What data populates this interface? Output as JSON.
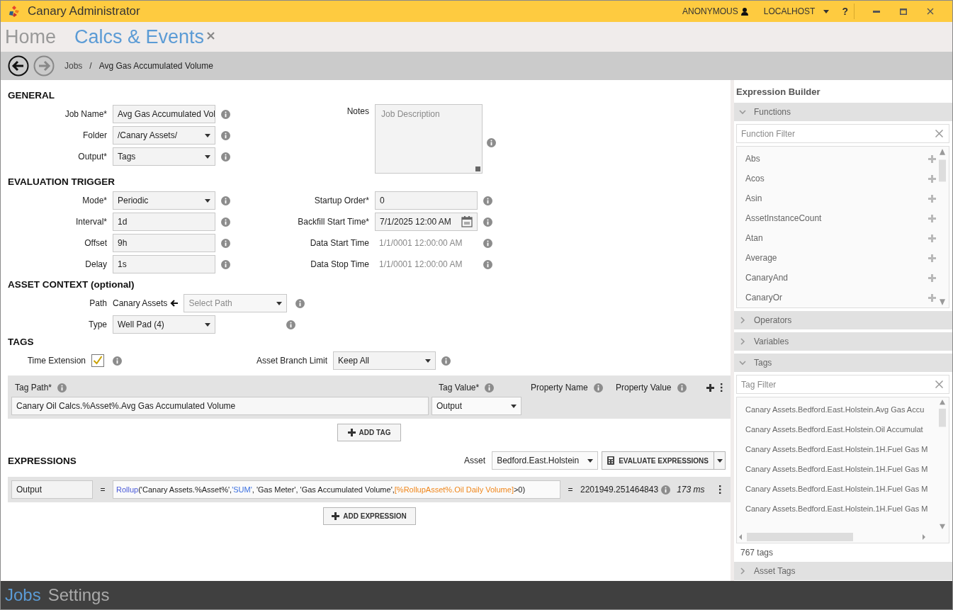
{
  "title_bar": {
    "app_title": "Canary Administrator",
    "user": "ANONYMOUS",
    "server": "LOCALHOST",
    "help": "?"
  },
  "top_tabs": [
    {
      "label": "Home",
      "selected": false,
      "closable": false
    },
    {
      "label": "Calcs & Events",
      "selected": true,
      "closable": true
    }
  ],
  "navigation": {
    "back_enabled": true,
    "forward_enabled": false
  },
  "breadcrumb": {
    "items": [
      "Jobs",
      "Avg Gas Accumulated Volume"
    ],
    "separator": "/"
  },
  "general": {
    "heading": "GENERAL",
    "fields": [
      {
        "label": "Job Name*",
        "kind": "text",
        "value": "Avg Gas Accumulated Vol"
      },
      {
        "label": "Folder",
        "kind": "dropdown",
        "value": "/Canary Assets/"
      },
      {
        "label": "Output*",
        "kind": "dropdown",
        "value": "Tags"
      }
    ],
    "notes": {
      "label": "Notes",
      "placeholder": "Job Description"
    }
  },
  "evaluation_trigger": {
    "heading": "EVALUATION TRIGGER",
    "left_fields": [
      {
        "label": "Mode*",
        "kind": "dropdown",
        "value": "Periodic"
      },
      {
        "label": "Interval*",
        "kind": "text",
        "value": "1d"
      },
      {
        "label": "Offset",
        "kind": "text",
        "value": "9h"
      },
      {
        "label": "Delay",
        "kind": "text",
        "value": "1s"
      }
    ],
    "right_fields": [
      {
        "label": "Startup Order*",
        "kind": "text",
        "value": "0"
      },
      {
        "label": "Backfill Start Time*",
        "kind": "date",
        "value": "7/1/2025 12:00 AM"
      },
      {
        "label": "Data Start Time",
        "kind": "readonly",
        "value": "1/1/0001 12:00:00 AM"
      },
      {
        "label": "Data Stop Time",
        "kind": "readonly",
        "value": "1/1/0001 12:00:00 AM"
      }
    ]
  },
  "asset_context": {
    "heading": "ASSET CONTEXT (optional)",
    "path": {
      "label": "Path",
      "value": "Canary Assets",
      "placeholder": "Select Path"
    },
    "type": {
      "label": "Type",
      "value": "Well Pad (4)"
    }
  },
  "tags": {
    "heading": "TAGS",
    "time_extension": {
      "label": "Time Extension",
      "checked": true
    },
    "asset_branch_limit": {
      "label": "Asset Branch Limit",
      "value": "Keep All"
    },
    "columns": [
      "Tag Path*",
      "Tag Value*",
      "Property Name",
      "Property Value"
    ],
    "rows": [
      {
        "tag_path": "Canary Oil Calcs.%Asset%.Avg Gas Accumulated Volume",
        "tag_value": "Output"
      }
    ],
    "add_button": "ADD TAG"
  },
  "expressions": {
    "heading": "EXPRESSIONS",
    "asset_label": "Asset",
    "asset": "Bedford.East.Holstein",
    "evaluate_button": "EVALUATE EXPRESSIONS",
    "rows": [
      {
        "name": "Output",
        "equals": "=",
        "expression": [
          {
            "text": "Rollup",
            "kind": "function"
          },
          {
            "text": "('Canary Assets.%Asset%', ",
            "kind": "plain"
          },
          {
            "text": "'SUM'",
            "kind": "keyword"
          },
          {
            "text": ", 'Gas Meter', 'Gas Accumulated Volume', ",
            "kind": "plain"
          },
          {
            "text": "[%RollupAsset%.Oil Daily Volume]",
            "kind": "tag"
          },
          {
            "text": ">0)",
            "kind": "plain"
          }
        ],
        "result_equals": "=",
        "result": "2201949.251464843",
        "duration": "173 ms"
      }
    ],
    "add_button": "ADD EXPRESSION"
  },
  "expression_builder": {
    "title": "Expression Builder",
    "sections": [
      {
        "title": "Functions",
        "kind": "functions",
        "expanded": true,
        "filter_placeholder": "Function Filter",
        "items": [
          "Abs",
          "Acos",
          "Asin",
          "AssetInstanceCount",
          "Atan",
          "Average",
          "CanaryAnd",
          "CanaryOr"
        ]
      },
      {
        "title": "Operators",
        "expanded": false
      },
      {
        "title": "Variables",
        "expanded": false
      },
      {
        "title": "Tags",
        "kind": "tags",
        "expanded": true,
        "filter_placeholder": "Tag Filter",
        "items": [
          "Canary Assets.Bedford.East.Holstein.Avg Gas Accu",
          "Canary Assets.Bedford.East.Holstein.Oil Accumulat",
          "Canary Assets.Bedford.East.Holstein.1H.Fuel Gas M",
          "Canary Assets.Bedford.East.Holstein.1H.Fuel Gas M",
          "Canary Assets.Bedford.East.Holstein.1H.Fuel Gas M",
          "Canary Assets.Bedford.East.Holstein.1H.Fuel Gas M"
        ],
        "count": "767 tags"
      },
      {
        "title": "Asset Tags",
        "expanded": false
      }
    ]
  },
  "bottom_nav": [
    {
      "label": "Jobs",
      "selected": true
    },
    {
      "label": "Settings",
      "selected": false
    }
  ]
}
